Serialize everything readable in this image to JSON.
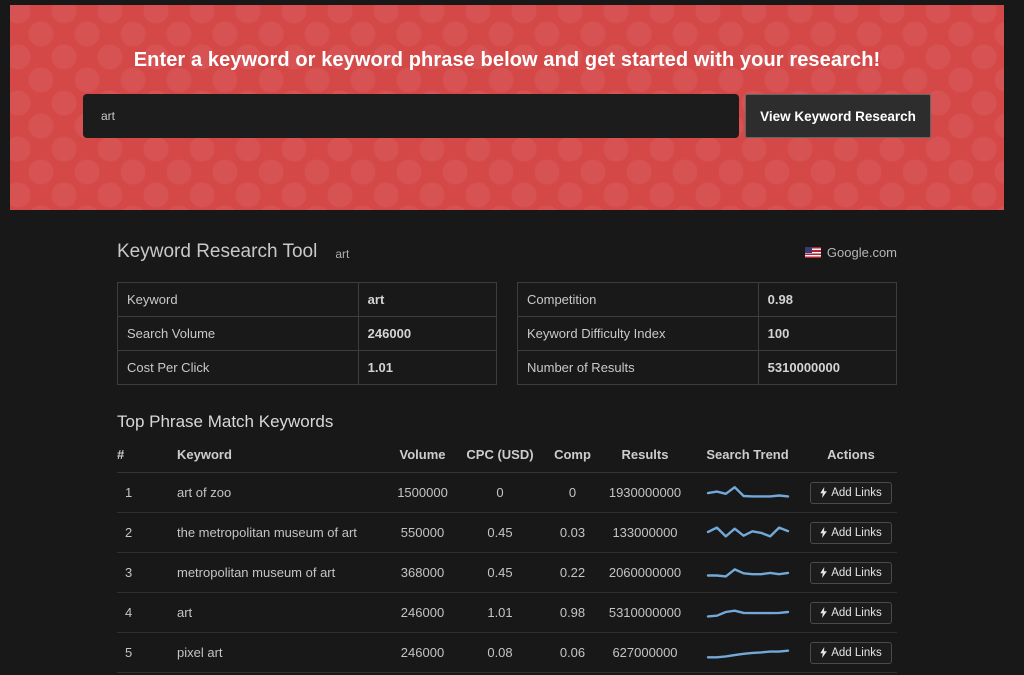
{
  "banner": {
    "headline": "Enter a keyword or keyword phrase below and get started with your research!",
    "search_value": "art",
    "button_label": "View Keyword Research",
    "accent_color": "#d54848"
  },
  "header": {
    "title": "Keyword Research Tool",
    "subtitle": "art",
    "source_label": "Google.com",
    "flag_icon": "us-flag-icon"
  },
  "summary": {
    "left": [
      {
        "label": "Keyword",
        "value": "art"
      },
      {
        "label": "Search Volume",
        "value": "246000"
      },
      {
        "label": "Cost Per Click",
        "value": "1.01"
      }
    ],
    "right": [
      {
        "label": "Competition",
        "value": "0.98"
      },
      {
        "label": "Keyword Difficulty Index",
        "value": "100"
      },
      {
        "label": "Number of Results",
        "value": "5310000000"
      }
    ]
  },
  "keywords_section": {
    "heading": "Top Phrase Match Keywords",
    "columns": [
      "#",
      "Keyword",
      "Volume",
      "CPC (USD)",
      "Comp",
      "Results",
      "Search Trend",
      "Actions"
    ],
    "add_links_label": "Add Links",
    "bolt_icon": "lightning-bolt",
    "trend_color": "#72a9d8",
    "rows": [
      {
        "rank": "1",
        "keyword": "art of zoo",
        "volume": "1500000",
        "cpc": "0",
        "comp": "0",
        "results": "1930000000",
        "trend": [
          4.5,
          5.2,
          4.2,
          7.2,
          3.2,
          3.0,
          3.0,
          3.0,
          3.4,
          3.0
        ]
      },
      {
        "rank": "2",
        "keyword": "the metropolitan museum of art",
        "volume": "550000",
        "cpc": "0.45",
        "comp": "0.03",
        "results": "133000000",
        "trend": [
          5.0,
          7.0,
          3.0,
          6.5,
          3.3,
          5.3,
          4.6,
          3.0,
          7.0,
          5.4
        ]
      },
      {
        "rank": "3",
        "keyword": "metropolitan museum of art",
        "volume": "368000",
        "cpc": "0.45",
        "comp": "0.22",
        "results": "2060000000",
        "trend": [
          3.4,
          3.4,
          3.0,
          6.2,
          4.4,
          4.0,
          4.0,
          4.6,
          4.0,
          4.6
        ]
      },
      {
        "rank": "4",
        "keyword": "art",
        "volume": "246000",
        "cpc": "1.01",
        "comp": "0.98",
        "results": "5310000000",
        "trend": [
          3.0,
          3.3,
          5.0,
          5.6,
          4.6,
          4.5,
          4.5,
          4.5,
          4.6,
          5.0
        ]
      },
      {
        "rank": "5",
        "keyword": "pixel art",
        "volume": "246000",
        "cpc": "0.08",
        "comp": "0.06",
        "results": "627000000",
        "trend": [
          2.6,
          2.6,
          3.0,
          3.6,
          4.2,
          4.6,
          4.8,
          5.2,
          5.2,
          5.6
        ]
      }
    ]
  }
}
